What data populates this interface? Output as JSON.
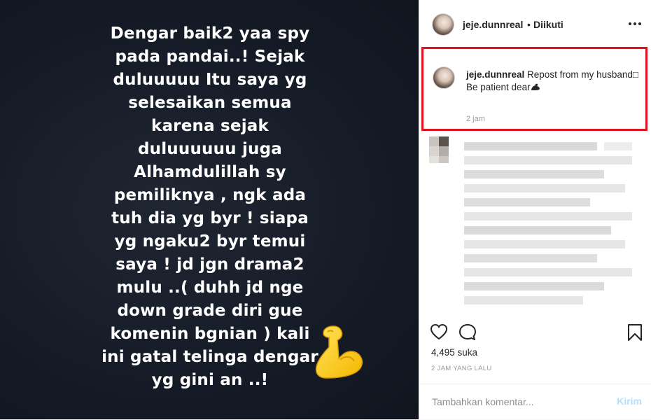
{
  "story": {
    "text": "Dengar baik2 yaa spy\npada pandai..! Sejak\nduluuuuu Itu saya yg\nselesaikan semua\nkarena sejak\nduluuuuuu juga\nAlhamdulillah sy\npemiliknya , ngk ada\ntuh dia yg byr ! siapa\nyg ngaku2 byr temui\nsaya ! jd jgn drama2\nmulu ..( duhh jd nge\ndown grade diri gue\nkomenin bgnian ) kali\nini gatal telinga dengar\nyg gini an ..!",
    "emoji": "flexed-biceps-icon"
  },
  "header": {
    "username": "jeje.dunnreal",
    "separator": "•",
    "follow_status": "Diikuti"
  },
  "caption": {
    "username": "jeje.dunnreal",
    "text": "Repost from my husband□",
    "line2": "Be patient dear",
    "time": "2 jam",
    "highlight_color": "#e0141e"
  },
  "actions": {
    "likes": "4,495 suka",
    "posted": "2 JAM YANG LALU"
  },
  "comment_box": {
    "placeholder": "Tambahkan komentar...",
    "post_label": "Kirim"
  },
  "colors": {
    "story_bg": "#161c27",
    "accent_disabled": "#b2dffc",
    "text_primary": "#262626",
    "text_secondary": "#999999"
  }
}
